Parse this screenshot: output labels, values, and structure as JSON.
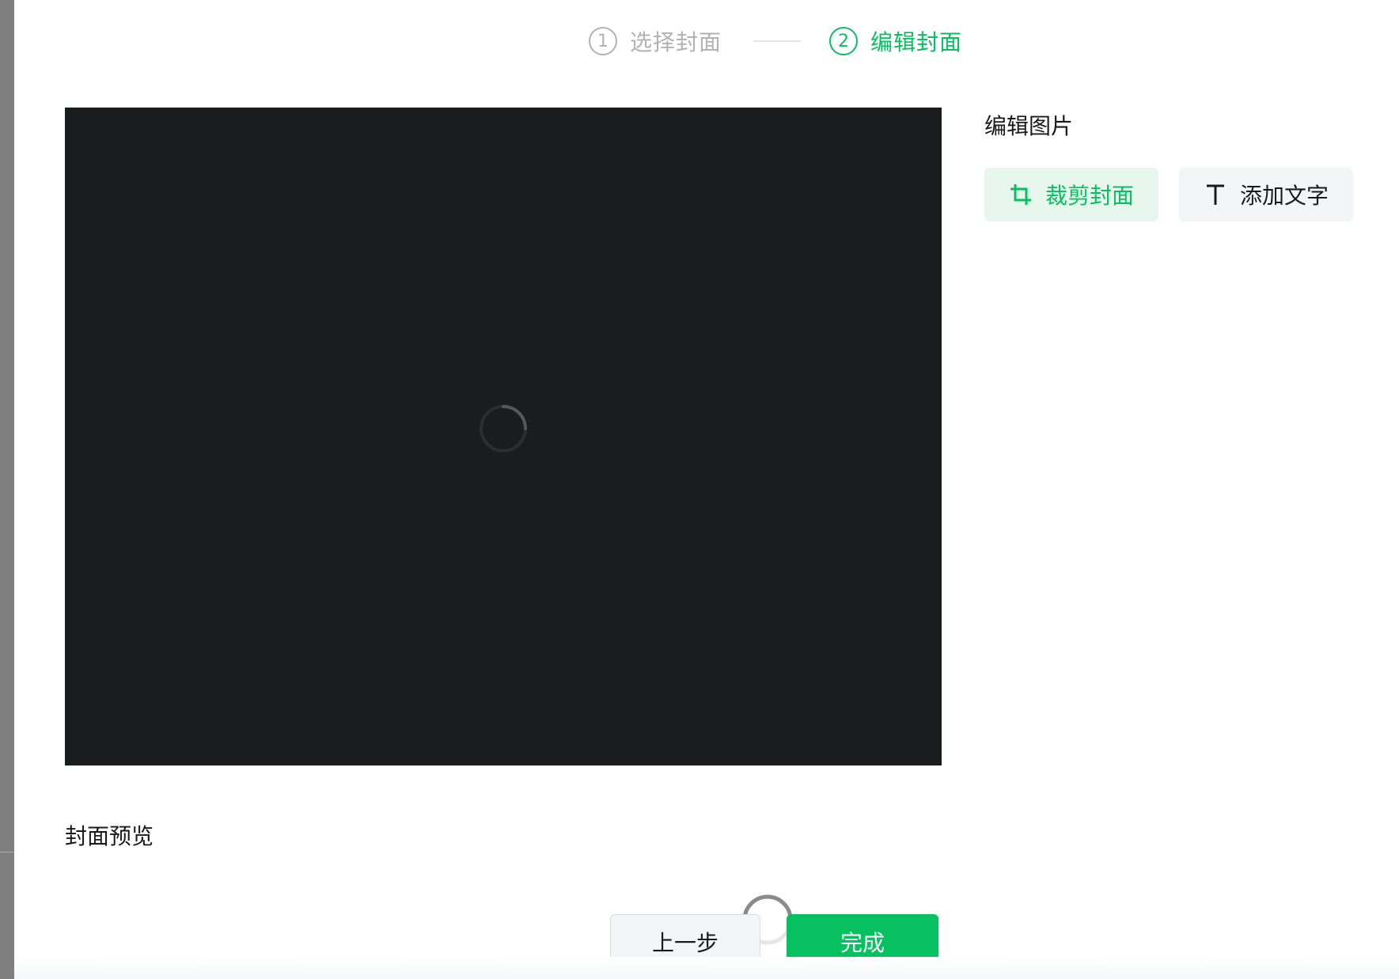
{
  "steps": [
    {
      "number": "1",
      "label": "选择封面",
      "active": false
    },
    {
      "number": "2",
      "label": "编辑封面",
      "active": true
    }
  ],
  "editor": {
    "panel_title": "编辑图片",
    "tools": [
      {
        "icon": "crop-icon",
        "label": "裁剪封面",
        "selected": true
      },
      {
        "icon": "text-icon",
        "label": "添加文字",
        "selected": false
      }
    ]
  },
  "preview": {
    "title": "封面预览"
  },
  "footer": {
    "prev_label": "上一步",
    "done_label": "完成"
  },
  "colors": {
    "accent": "#07c160",
    "canvas_bg": "#1b1c1e",
    "inactive": "#b2b2b2"
  }
}
